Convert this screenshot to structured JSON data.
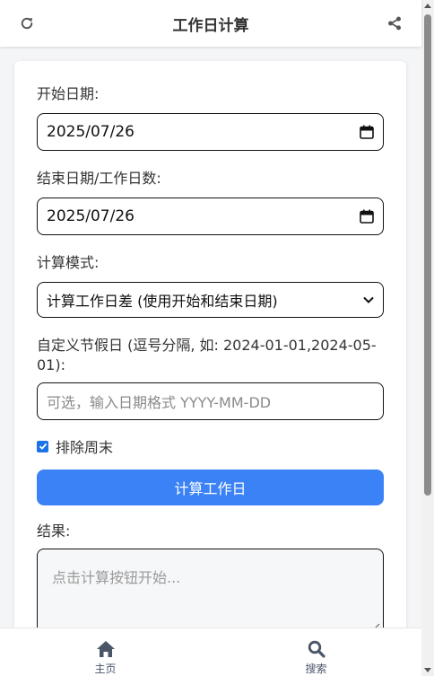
{
  "header": {
    "title": "工作日计算",
    "left_icon": "refresh-icon",
    "right_icon": "share-icon"
  },
  "form": {
    "start_date": {
      "label": "开始日期:",
      "value": "2025/07/26"
    },
    "end_date": {
      "label": "结束日期/工作日数:",
      "value": "2025/07/26"
    },
    "mode": {
      "label": "计算模式:",
      "selected": "计算工作日差 (使用开始和结束日期)"
    },
    "holidays": {
      "label": "自定义节假日 (逗号分隔, 如: 2024-01-01,2024-05-01):",
      "placeholder": "可选，输入日期格式 YYYY-MM-DD",
      "value": ""
    },
    "exclude_weekends": {
      "label": "排除周末",
      "checked": true
    },
    "calculate_button": "计算工作日",
    "result": {
      "label": "结果:",
      "placeholder": "点击计算按钮开始..."
    }
  },
  "bottom_nav": {
    "items": [
      {
        "label": "主页",
        "icon": "home-icon"
      },
      {
        "label": "搜索",
        "icon": "search-icon"
      }
    ]
  },
  "colors": {
    "accent": "#3b82f6",
    "checkbox": "#1a73e8",
    "nav_icon": "#4a5568"
  }
}
